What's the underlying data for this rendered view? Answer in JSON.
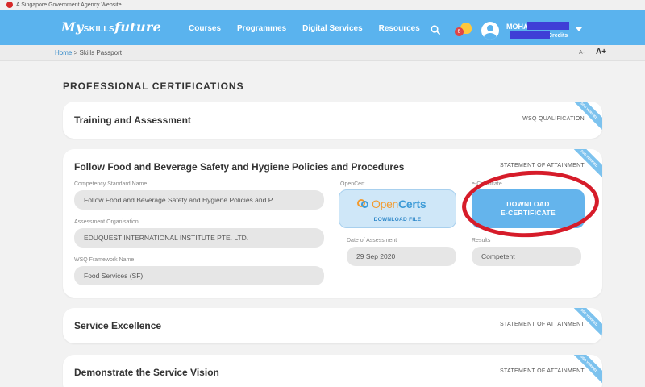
{
  "gov_banner": "A Singapore Government Agency Website",
  "header": {
    "logo_my": "My",
    "logo_skills": "SKILLS",
    "logo_future": "future",
    "nav": [
      "Courses",
      "Programmes",
      "Digital Services",
      "Resources"
    ],
    "notification_count": "6",
    "user_name_visible": "MOHA",
    "user_line2_visible": "Credits",
    "accent_color": "#5ab3ee"
  },
  "breadcrumb": {
    "home": "Home",
    "separator": ">",
    "current": "Skills Passport"
  },
  "font_controls": {
    "decrease": "A-",
    "increase": "A+"
  },
  "page_title": "PROFESSIONAL CERTIFICATIONS",
  "ribbon_text": "SSG VERIFIED",
  "cards": {
    "training": {
      "title": "Training and Assessment",
      "type": "WSQ QUALIFICATION"
    },
    "food": {
      "title": "Follow Food and Beverage Safety and Hygiene Policies and Procedures",
      "type": "STATEMENT OF ATTAINMENT",
      "competency_label": "Competency Standard Name",
      "competency_value": "Follow Food and Beverage Safety and Hygiene Policies and P",
      "org_label": "Assessment Organisation",
      "org_value": "EDUQUEST INTERNATIONAL INSTITUTE  PTE. LTD.",
      "framework_label": "WSQ Framework Name",
      "framework_value": "Food Services (SF)",
      "opencert_label": "OpenCert",
      "opencert_logo_a": "Open",
      "opencert_logo_b": "Certs",
      "opencert_download": "DOWNLOAD FILE",
      "ecert_label": "e-Certificate",
      "ecert_button_line1": "DOWNLOAD",
      "ecert_button_line2": "E-CERTIFICATE",
      "date_label": "Date of Assessment",
      "date_value": "29 Sep 2020",
      "results_label": "Results",
      "results_value": "Competent"
    },
    "service_excellence": {
      "title": "Service Excellence",
      "type": "STATEMENT OF ATTAINMENT"
    },
    "service_vision": {
      "title": "Demonstrate the Service Vision",
      "type": "STATEMENT OF ATTAINMENT"
    }
  }
}
